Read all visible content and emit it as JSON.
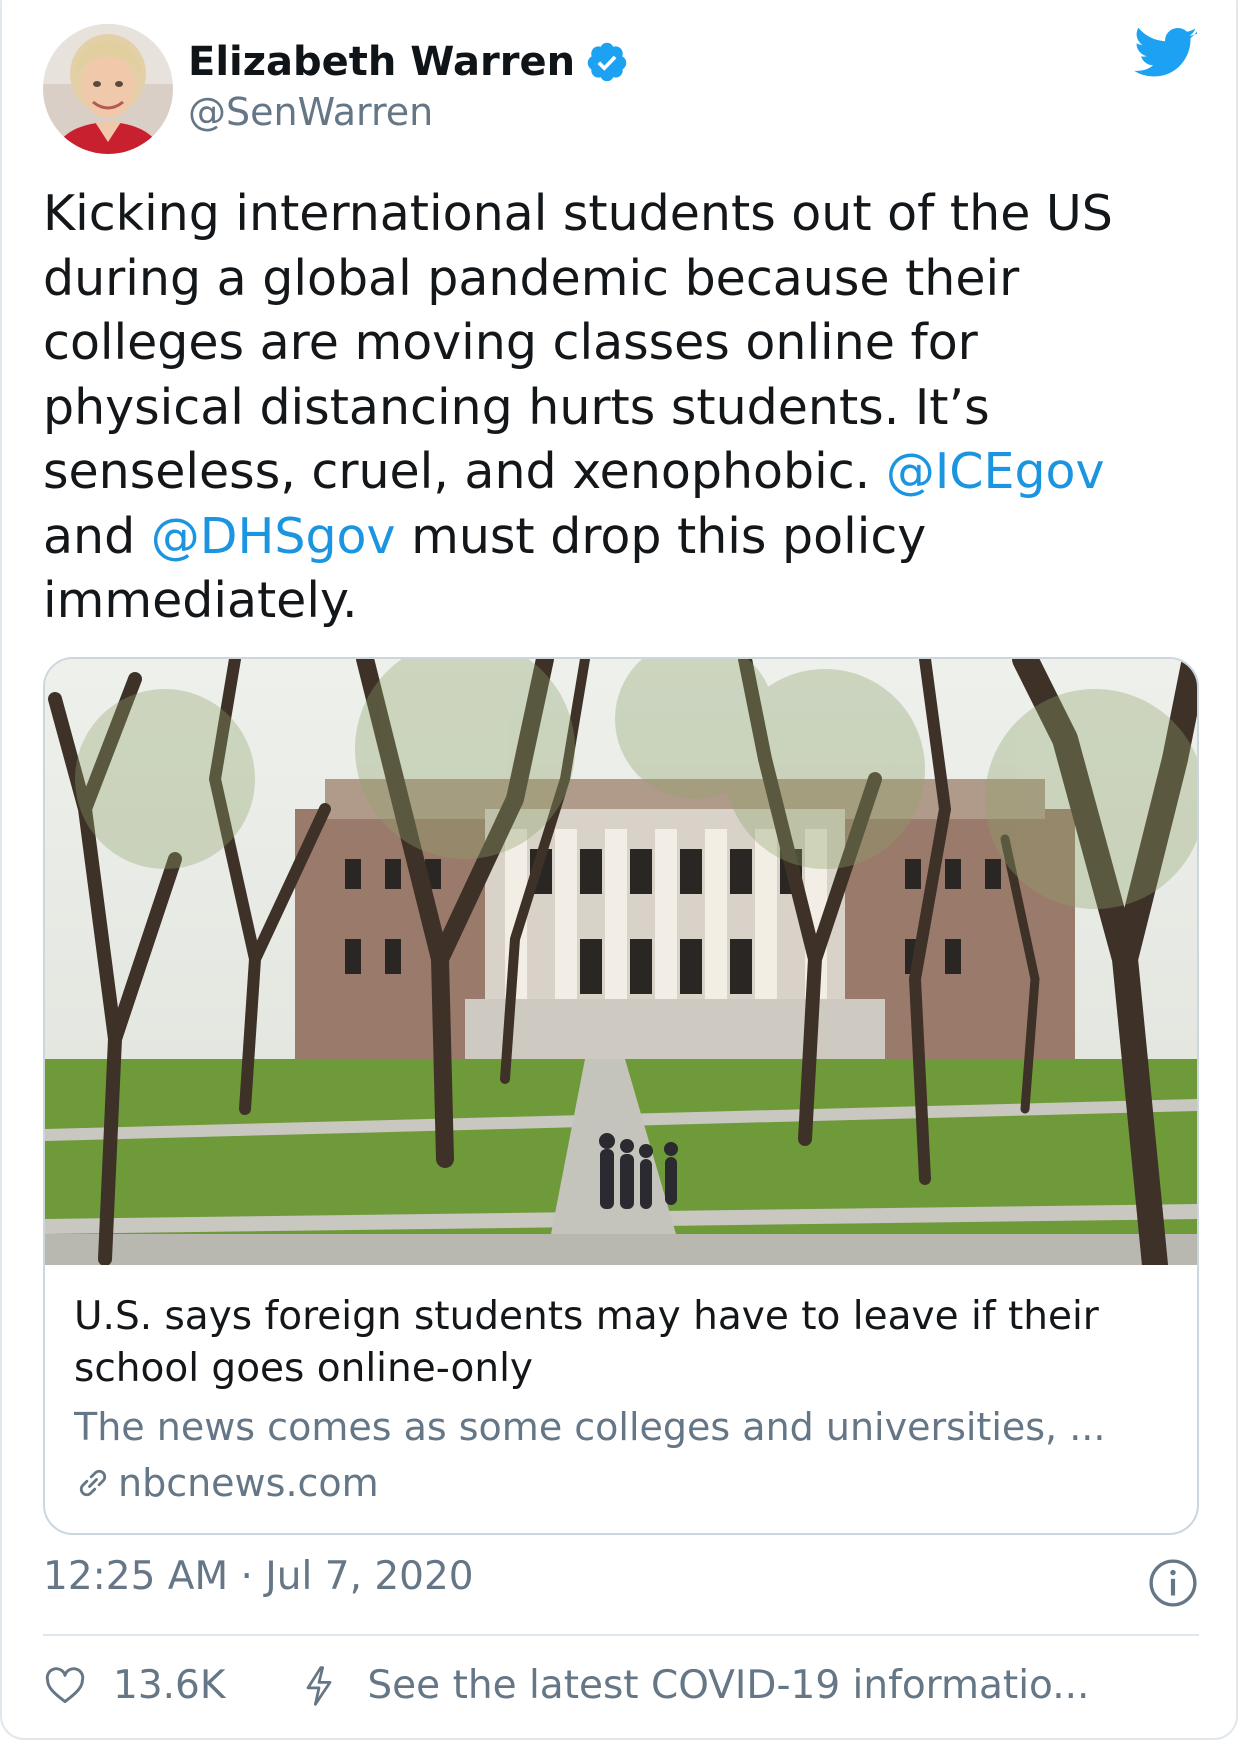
{
  "author": {
    "name": "Elizabeth Warren",
    "handle": "@SenWarren",
    "verified": true,
    "avatar_icon": "avatar-photo"
  },
  "brand": {
    "icon": "twitter-bird-icon",
    "color": "#1da1f2"
  },
  "tweet": {
    "lines": [
      "Kicking international students out of the US",
      "during a global pandemic because their",
      "colleges are moving classes online for",
      "physical distancing hurts students. It’s"
    ],
    "line5_text": "senseless, cruel, and xenophobic. ",
    "mention1": "@ICEgov",
    "line6_before": "and ",
    "mention2": "@DHSgov",
    "line6_after": " must drop this policy",
    "line7": "immediately.",
    "mention_color": "#1b95e0"
  },
  "link_card": {
    "image": "campus-photo",
    "title": "U.S. says foreign students may have to leave if their school goes online-only",
    "description": "The news comes as some colleges and universities, ...",
    "domain": "nbcnews.com",
    "link_icon": "link-icon"
  },
  "meta": {
    "timestamp": "12:25 AM · Jul 7, 2020",
    "info_icon": "info-icon"
  },
  "actions": {
    "like_icon": "heart-icon",
    "like_count": "13.6K",
    "covid_icon": "bolt-icon",
    "covid_text": "See the latest COVID-19 informatio..."
  }
}
